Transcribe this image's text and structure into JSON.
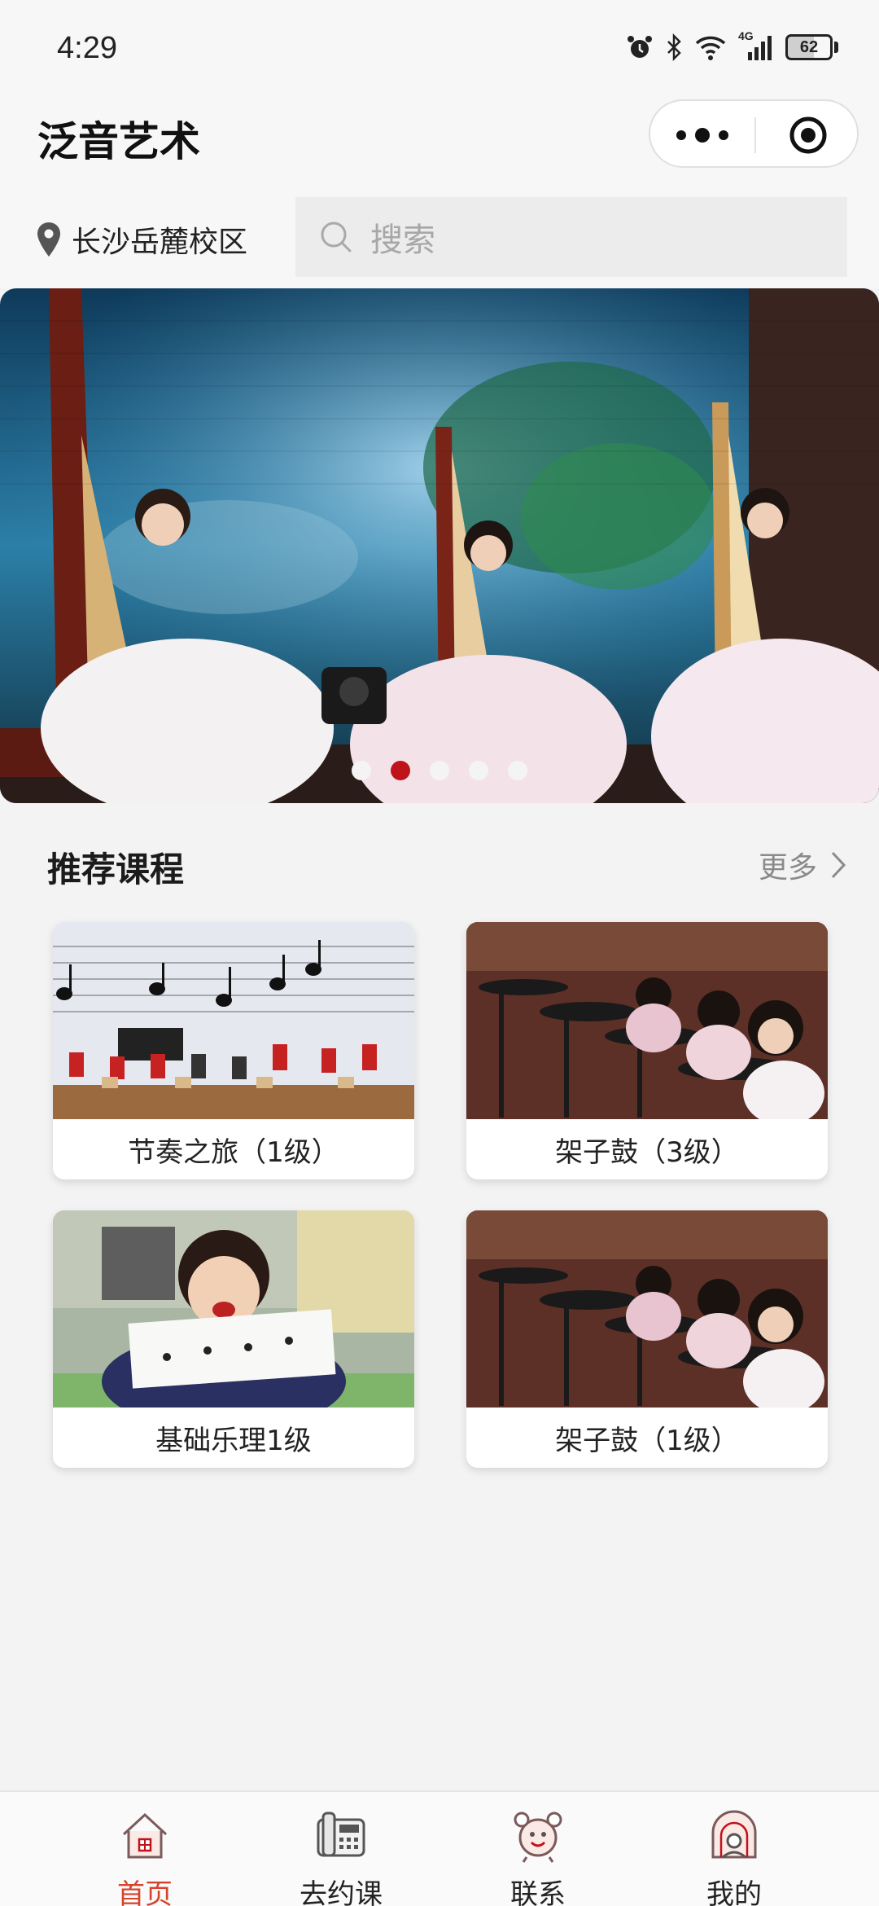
{
  "status_bar": {
    "time": "4:29",
    "network": "4G",
    "battery": "62"
  },
  "navbar": {
    "title": "泛音艺术"
  },
  "location": {
    "campus": "长沙岳麓校区"
  },
  "search": {
    "placeholder": "搜索"
  },
  "banner": {
    "slide_count": 5,
    "active_index": 1
  },
  "section": {
    "title": "推荐课程",
    "more_label": "更多"
  },
  "courses": [
    {
      "label": "节奏之旅（1级）"
    },
    {
      "label": "架子鼓（3级）"
    },
    {
      "label": "基础乐理1级"
    },
    {
      "label": "架子鼓（1级）"
    }
  ],
  "tabbar": {
    "items": [
      {
        "label": "首页",
        "icon": "house-icon",
        "active": true
      },
      {
        "label": "去约课",
        "icon": "phone-icon",
        "active": false
      },
      {
        "label": "联系",
        "icon": "alarm-clock-icon",
        "active": false
      },
      {
        "label": "我的",
        "icon": "profile-icon",
        "active": false
      }
    ]
  },
  "colors": {
    "accent": "#c0121b",
    "tab_active": "#d6432b"
  }
}
